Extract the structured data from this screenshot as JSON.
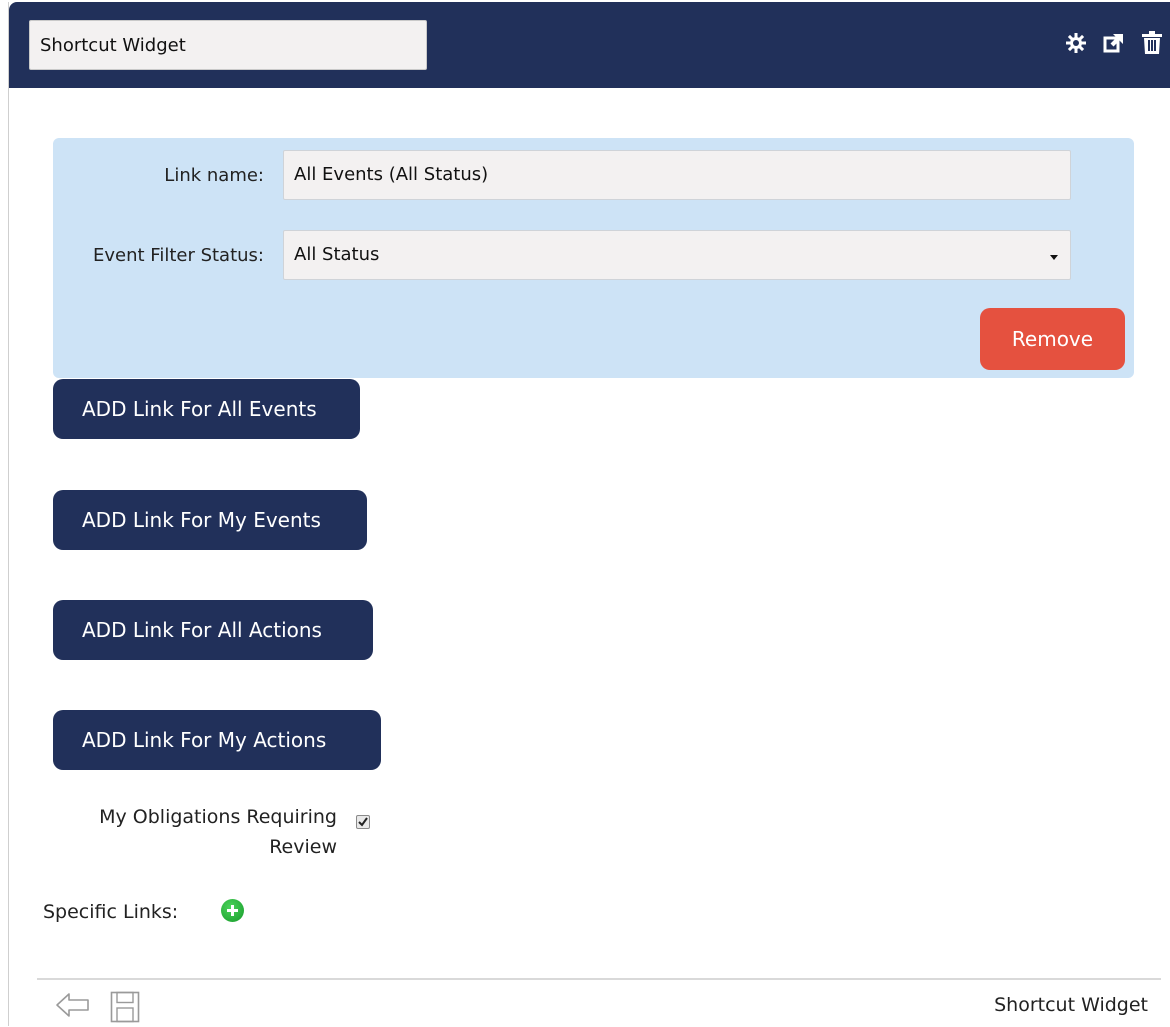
{
  "header": {
    "title_value": "Shortcut Widget",
    "icons": [
      "gear-icon",
      "popout-icon",
      "trash-icon"
    ]
  },
  "link_panel": {
    "link_name_label": "Link name:",
    "link_name_value": "All Events (All Status)",
    "event_filter_label": "Event Filter Status:",
    "event_filter_value": "All Status",
    "remove_label": "Remove"
  },
  "actions": {
    "add_all_events": "ADD Link For All Events",
    "add_my_events": "ADD Link For My Events",
    "add_all_actions": "ADD Link For All Actions",
    "add_my_actions": "ADD Link For My Actions"
  },
  "obligations": {
    "label": "My Obligations Requiring Review",
    "checked": true
  },
  "specific_links": {
    "label": "Specific Links:"
  },
  "footer": {
    "title": "Shortcut Widget",
    "icons": [
      "back-arrow-icon",
      "save-icon"
    ]
  },
  "colors": {
    "header_bg": "#21305a",
    "panel_bg": "#cde3f6",
    "remove_bg": "#e5513f",
    "button_bg": "#21305a",
    "add_green": "#2bb63d"
  }
}
